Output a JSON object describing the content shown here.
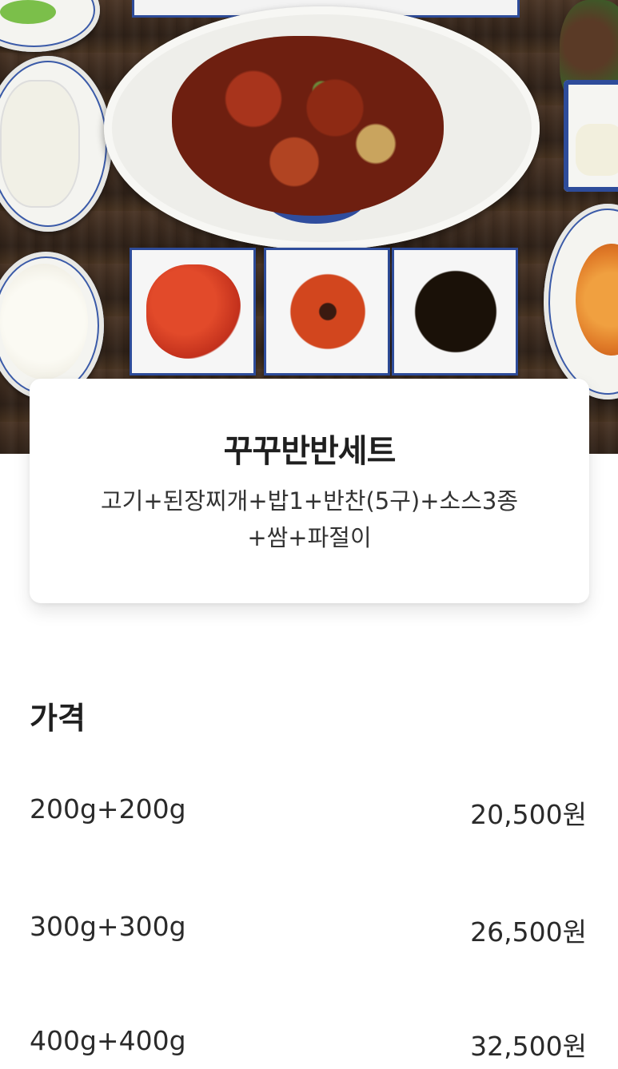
{
  "hero_image": {
    "alt": ""
  },
  "card": {
    "title": "꾸꾸반반세트",
    "description_line1": "고기+된장찌개+밥1+반찬(5구)+소스3종",
    "description_line2": "+쌈+파절이"
  },
  "price_section": {
    "title": "가격",
    "items": [
      {
        "weight": "200g+200g",
        "price": "20,500원"
      },
      {
        "weight": "300g+300g",
        "price": "26,500원"
      },
      {
        "weight": "400g+400g",
        "price": "32,500원"
      }
    ]
  }
}
